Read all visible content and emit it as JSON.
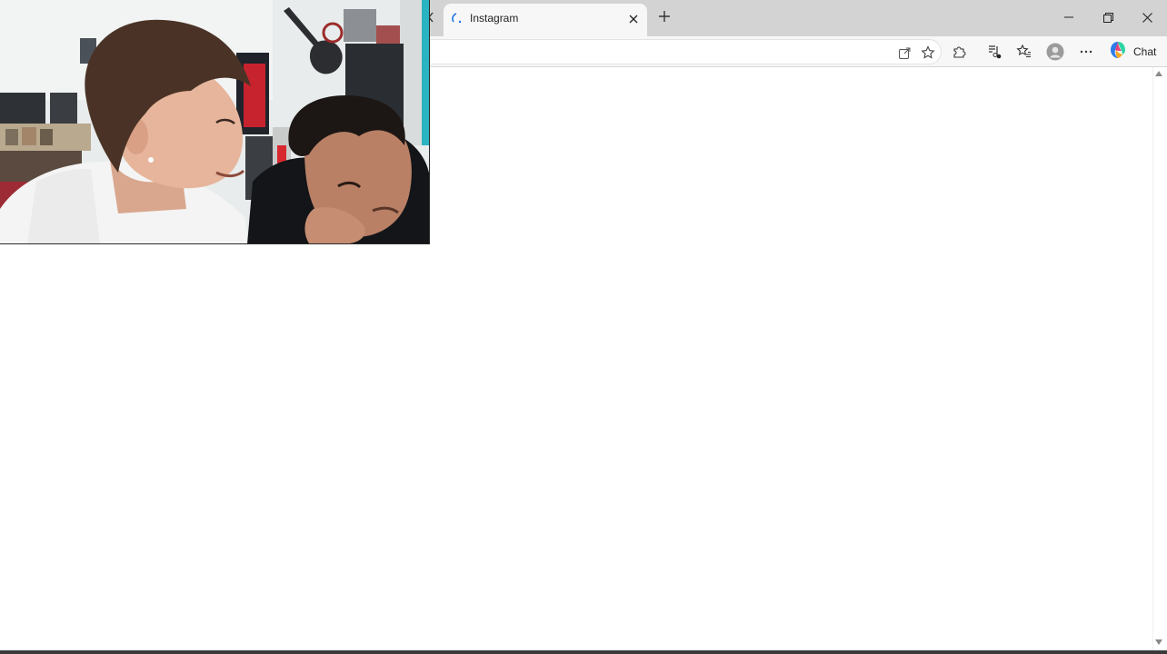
{
  "browser": {
    "tab": {
      "title": "Instagram",
      "favicon": "instagram-loading-icon"
    },
    "icons": {
      "tab_close": "close-icon",
      "new_tab": "plus-icon",
      "minimize": "minimize-icon",
      "restore": "restore-icon",
      "close": "close-icon",
      "open_in_app": "open-external-icon",
      "favorite": "star-icon",
      "extensions": "puzzle-icon",
      "media": "music-note-icon",
      "favorites": "favorites-icon",
      "profile": "profile-avatar-icon",
      "more": "ellipsis-icon",
      "copilot": "copilot-icon"
    },
    "toolbar": {
      "chat_label": "Chat"
    }
  },
  "webcam_overlay": {
    "description_visible": false
  },
  "colors": {
    "tabstrip": "#d3d3d3",
    "toolbar": "#f7f7f7",
    "page": "#ffffff",
    "teal_wall": "#2ab3c0"
  }
}
